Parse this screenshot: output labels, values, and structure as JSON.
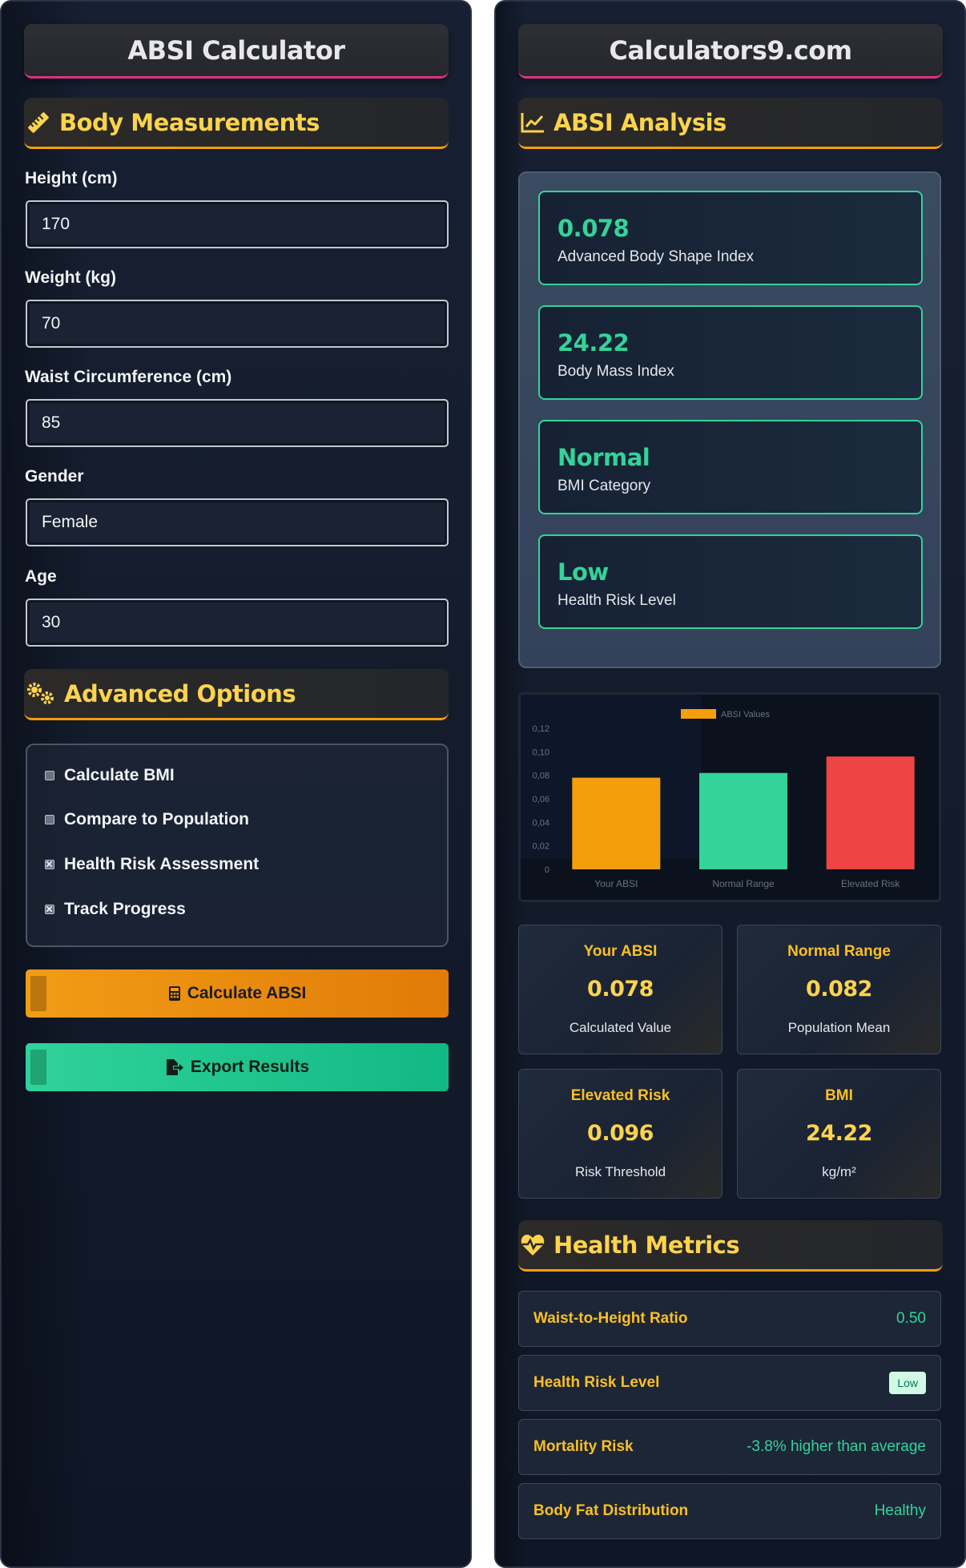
{
  "left": {
    "title": "ABSI Calculator",
    "body_section": {
      "title": "Body Measurements",
      "icon": "ruler-icon"
    },
    "fields": [
      {
        "label": "Height (cm)",
        "value": "170"
      },
      {
        "label": "Weight (kg)",
        "value": "70"
      },
      {
        "label": "Waist Circumference (cm)",
        "value": "85"
      },
      {
        "label": "Gender",
        "value": "Female"
      },
      {
        "label": "Age",
        "value": "30"
      }
    ],
    "advanced_section": {
      "title": "Advanced Options",
      "icon": "gears-icon"
    },
    "options": [
      {
        "label": "Calculate BMI",
        "checked": false
      },
      {
        "label": "Compare to Population",
        "checked": false
      },
      {
        "label": "Health Risk Assessment",
        "checked": true
      },
      {
        "label": "Track Progress",
        "checked": true
      }
    ],
    "calculate_label": "Calculate ABSI",
    "export_label": "Export Results"
  },
  "right": {
    "title": "Calculators9.com",
    "analysis_section": {
      "title": "ABSI Analysis",
      "icon": "chart-line-icon"
    },
    "results": [
      {
        "value": "0.078",
        "label": "Advanced Body Shape Index"
      },
      {
        "value": "24.22",
        "label": "Body Mass Index"
      },
      {
        "value": "Normal",
        "label": "BMI Category"
      },
      {
        "value": "Low",
        "label": "Health Risk Level"
      }
    ],
    "stats": [
      {
        "title": "Your ABSI",
        "value": "0.078",
        "sub": "Calculated Value"
      },
      {
        "title": "Normal Range",
        "value": "0.082",
        "sub": "Population Mean"
      },
      {
        "title": "Elevated Risk",
        "value": "0.096",
        "sub": "Risk Threshold"
      },
      {
        "title": "BMI",
        "value": "24.22",
        "sub": "kg/m²"
      }
    ],
    "health_section": {
      "title": "Health Metrics",
      "icon": "heartbeat-icon"
    },
    "metrics": [
      {
        "name": "Waist-to-Height Ratio",
        "value": "0.50"
      },
      {
        "name": "Health Risk Level",
        "value": "Low"
      },
      {
        "name": "Mortality Risk",
        "value": "-3.8% higher than average"
      },
      {
        "name": "Body Fat Distribution",
        "value": "Healthy"
      }
    ]
  },
  "colors": {
    "accent": "#f59e0b",
    "success": "#34d399",
    "danger": "#ef4444",
    "pink": "#e0307e"
  },
  "chart_data": {
    "type": "bar",
    "categories": [
      "Your ABSI",
      "Normal Range",
      "Elevated Risk"
    ],
    "series": [
      {
        "name": "ABSI Values",
        "values": [
          0.078,
          0.082,
          0.096
        ]
      }
    ],
    "colors": [
      "#f59e0b",
      "#34d399",
      "#ef4444"
    ],
    "ylim": [
      0,
      0.12
    ],
    "yticks": [
      "0",
      "0,02",
      "0,04",
      "0,06",
      "0,08",
      "0,10",
      "0,12"
    ],
    "legend": "top-center",
    "grid": false
  }
}
